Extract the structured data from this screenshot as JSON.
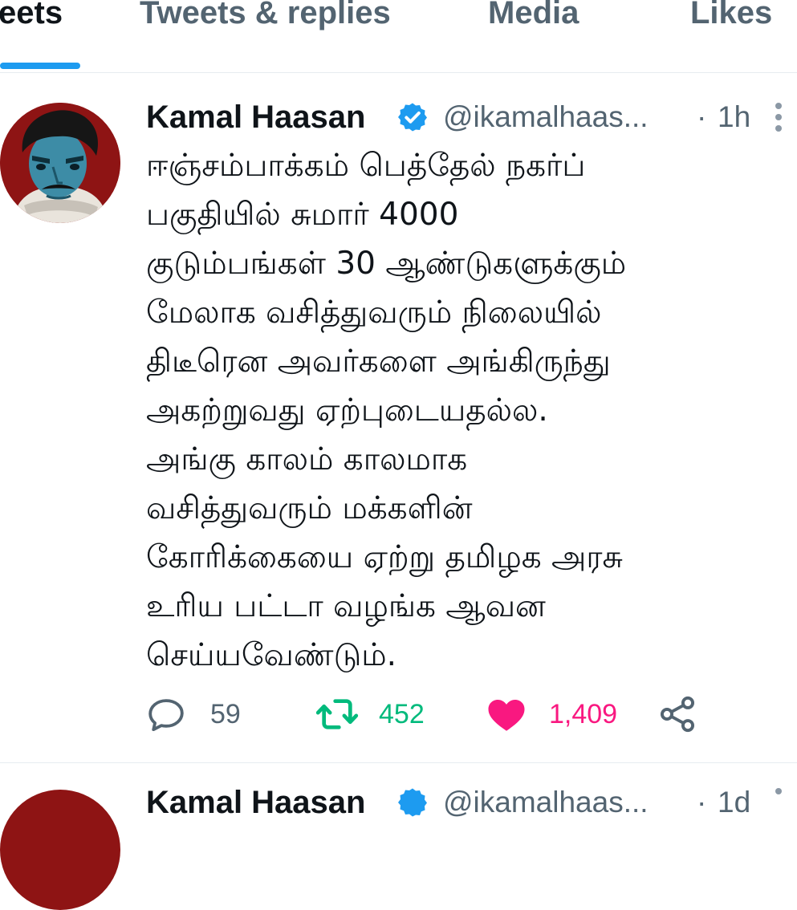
{
  "tabs": [
    {
      "label": "eets",
      "active": true
    },
    {
      "label": "Tweets & replies",
      "active": false
    },
    {
      "label": "Media",
      "active": false
    },
    {
      "label": "Likes",
      "active": false
    }
  ],
  "tweet": {
    "author_name": "Kamal Haasan",
    "handle": "@ikamalhaas...",
    "separator": "·",
    "time": "1h",
    "verified": true,
    "text_lines": [
      "ஈஞ்சம்பாக்கம் பெத்தேல் நகர்ப்",
      "பகுதியில் சுமார் 4000",
      "குடும்பங்கள் 30 ஆண்டுகளுக்கும்",
      "மேலாக வசித்துவரும் நிலையில்",
      "திடீரென அவர்களை அங்கிருந்து",
      "அகற்றுவது ஏற்புடையதல்ல.",
      "அங்கு காலம் காலமாக",
      "வசித்துவரும் மக்களின்",
      "கோரிக்கையை ஏற்று தமிழக அரசு",
      "உரிய பட்டா வழங்க ஆவன",
      "செய்யவேண்டும்."
    ],
    "reply_count": "59",
    "retweet_count": "452",
    "like_count": "1,409",
    "liked": true,
    "icons": {
      "reply": "reply-icon",
      "retweet": "retweet-icon",
      "like": "heart-icon",
      "share": "share-icon",
      "more": "more-vertical-icon",
      "verified": "verified-badge-icon"
    }
  },
  "next_tweet": {
    "author_name": "Kamal Haasan",
    "handle": "@ikamalhaas...",
    "separator": "·",
    "time": "1d"
  },
  "colors": {
    "accent": "#1d9bf0",
    "retweet": "#00ba7c",
    "like": "#f91880",
    "secondary_text": "#536471",
    "avatar_bg": "#8e1414"
  }
}
